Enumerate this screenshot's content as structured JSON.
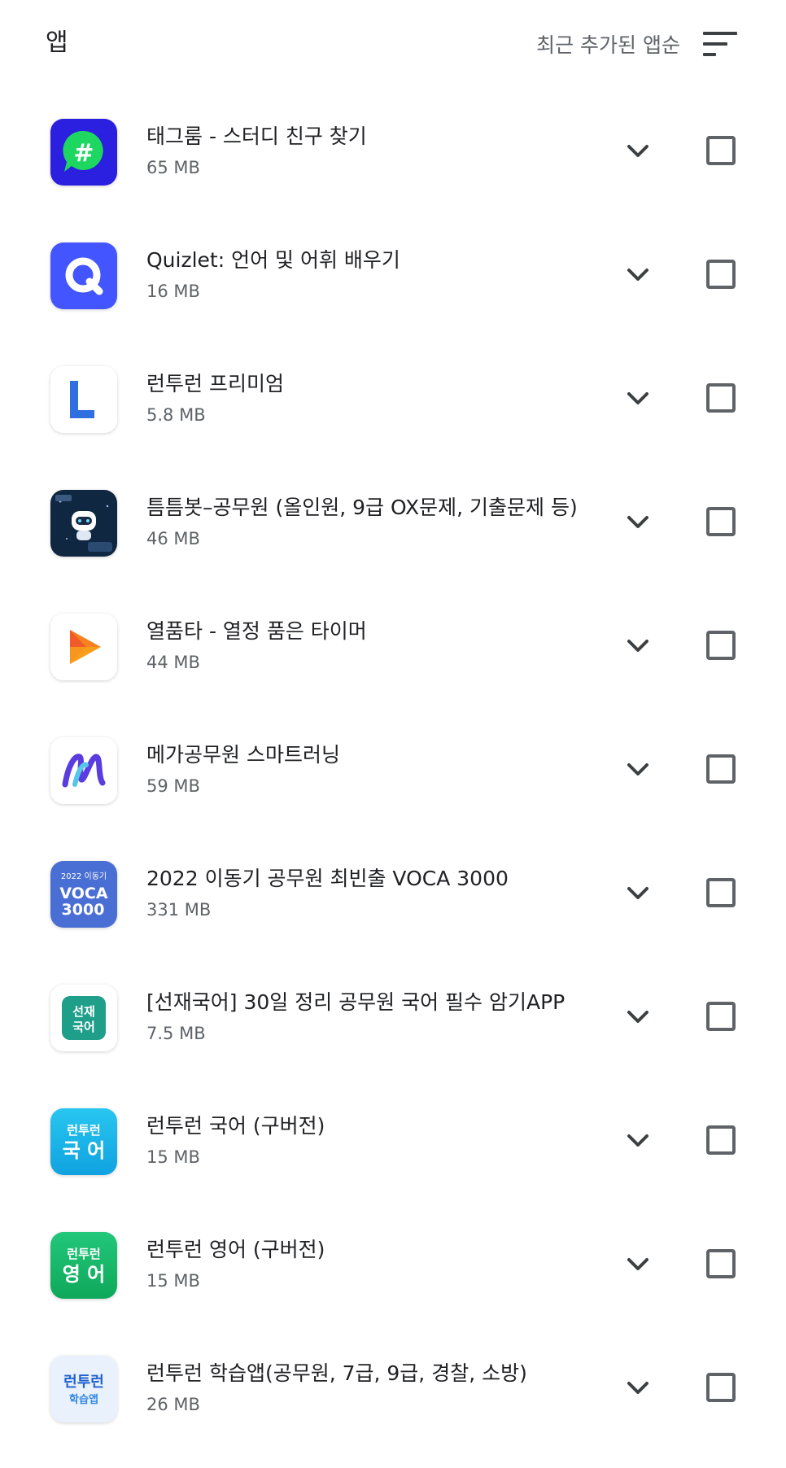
{
  "header": {
    "title": "앱",
    "sort_label": "최근 추가된 앱순",
    "sort_icon": "sort-icon"
  },
  "apps": [
    {
      "name": "태그룸 - 스터디 친구 찾기",
      "size": "65 MB",
      "icon": "tagroom-icon",
      "color": "#2b1fe0"
    },
    {
      "name": "Quizlet: 언어 및 어휘 배우기",
      "size": "16 MB",
      "icon": "quizlet-icon",
      "color": "#4255ff"
    },
    {
      "name": "런투런 프리미엄",
      "size": "5.8 MB",
      "icon": "runtorun-premium-icon",
      "color": "#2f6fe0"
    },
    {
      "name": "틈틈봇–공무원 (올인원, 9급 OX문제, 기출문제 등)",
      "size": "46 MB",
      "icon": "teumteumbot-icon",
      "color": "#0f2740"
    },
    {
      "name": "열품타 -  열정 품은 타이머",
      "size": "44 MB",
      "icon": "yeolpumta-icon",
      "color": "#f5821f"
    },
    {
      "name": "메가공무원 스마트러닝",
      "size": "59 MB",
      "icon": "megagongmuwon-icon",
      "color": "#4a3cd6"
    },
    {
      "name": "2022 이동기 공무원 최빈출 VOCA 3000",
      "size": "331 MB",
      "icon": "voca3000-icon",
      "color": "#4a6fd4",
      "icon_text": [
        "2022 이동기",
        "VOCA",
        "3000"
      ]
    },
    {
      "name": "[선재국어] 30일 정리 공무원 국어 필수 암기APP",
      "size": "7.5 MB",
      "icon": "seonjae-korean-icon",
      "color": "#1f9e8a",
      "icon_text": [
        "선재",
        "국어"
      ]
    },
    {
      "name": "런투런 국어 (구버전)",
      "size": "15 MB",
      "icon": "runtorun-korean-icon",
      "color": "#18b6e6",
      "icon_text": [
        "런투런",
        "국 어"
      ]
    },
    {
      "name": "런투런 영어 (구버전)",
      "size": "15 MB",
      "icon": "runtorun-english-icon",
      "color": "#14b86a",
      "icon_text": [
        "런투런",
        "영 어"
      ]
    },
    {
      "name": "런투런 학습앱(공무원, 7급, 9급, 경찰, 소방)",
      "size": "26 MB",
      "icon": "runtorun-study-icon",
      "color": "#e9f1fc",
      "icon_text": [
        "런투런",
        "학습앱"
      ]
    }
  ],
  "row_icons": {
    "expand": "chevron-down-icon",
    "checkbox": "checkbox"
  }
}
